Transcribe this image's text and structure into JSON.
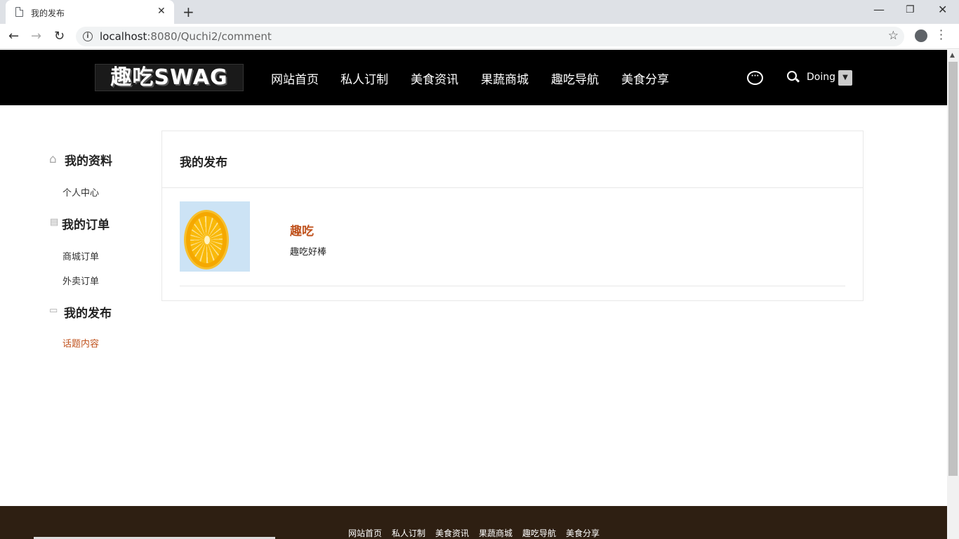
{
  "browser": {
    "tab_title": "我的发布",
    "url_host": "localhost",
    "url_path": ":8080/Quchi2/comment"
  },
  "header": {
    "logo": "趣吃SWAG",
    "nav": [
      "网站首页",
      "私人订制",
      "美食资讯",
      "果蔬商城",
      "趣吃导航",
      "美食分享"
    ],
    "user_name": "Doing"
  },
  "sidebar": {
    "groups": [
      {
        "title": "我的资料",
        "icon": "home-icon",
        "items": [
          {
            "label": "个人中心",
            "active": false
          }
        ]
      },
      {
        "title": "我的订单",
        "icon": "document-icon",
        "items": [
          {
            "label": "商城订单",
            "active": false
          },
          {
            "label": "外卖订单",
            "active": false
          }
        ]
      },
      {
        "title": "我的发布",
        "icon": "comment-icon",
        "items": [
          {
            "label": "话题内容",
            "active": true
          }
        ]
      }
    ]
  },
  "main": {
    "title": "我的发布",
    "posts": [
      {
        "title": "趣吃",
        "body": "趣吃好棒",
        "image": "orange-slice"
      }
    ]
  },
  "footer": {
    "links": [
      "网站首页",
      "私人订制",
      "美食资讯",
      "果蔬商城",
      "趣吃导航",
      "美食分享"
    ]
  },
  "colors": {
    "accent": "#c0531e",
    "header_bg": "#000000",
    "footer_bg": "#2e1f12"
  }
}
